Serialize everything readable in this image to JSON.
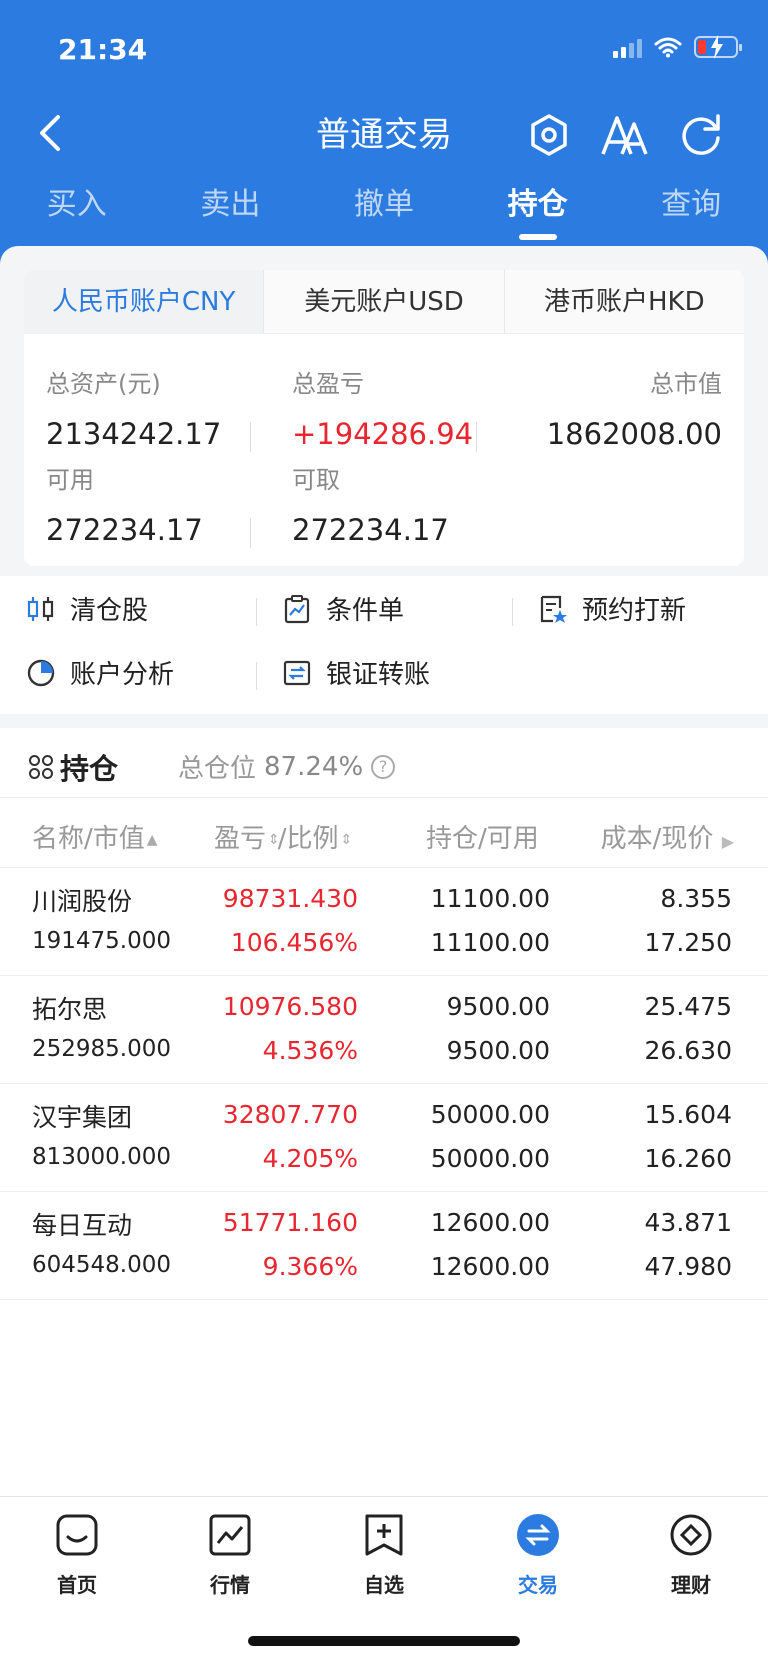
{
  "status_bar": {
    "time": "21:34"
  },
  "nav": {
    "title": "普通交易"
  },
  "tabs": [
    {
      "label": "买入"
    },
    {
      "label": "卖出"
    },
    {
      "label": "撤单"
    },
    {
      "label": "持仓"
    },
    {
      "label": "查询"
    }
  ],
  "account_tabs": [
    {
      "label": "人民币账户CNY"
    },
    {
      "label": "美元账户USD"
    },
    {
      "label": "港币账户HKD"
    }
  ],
  "summary": {
    "total_assets_label": "总资产(元)",
    "total_assets": "2134242.17",
    "total_pl_label": "总盈亏",
    "total_pl": "+194286.94",
    "market_value_label": "总市值",
    "market_value": "1862008.00",
    "available_label": "可用",
    "available": "272234.17",
    "withdrawable_label": "可取",
    "withdrawable": "272234.17"
  },
  "quick_actions": [
    {
      "label": "清仓股"
    },
    {
      "label": "条件单"
    },
    {
      "label": "预约打新"
    },
    {
      "label": "账户分析"
    },
    {
      "label": "银证转账"
    }
  ],
  "holdings": {
    "title": "持仓",
    "position_label": "总仓位",
    "position_value": "87.24%",
    "columns": {
      "name": "名称/市值",
      "pl": "盈亏",
      "ratio": "/比例",
      "qty": "持仓/可用",
      "cost": "成本/现价"
    },
    "rows": [
      {
        "name": "川润股份",
        "market_value": "191475.000",
        "pl": "98731.430",
        "ratio": "106.456%",
        "hold": "11100.00",
        "avail": "11100.00",
        "cost": "8.355",
        "price": "17.250"
      },
      {
        "name": "拓尔思",
        "market_value": "252985.000",
        "pl": "10976.580",
        "ratio": "4.536%",
        "hold": "9500.00",
        "avail": "9500.00",
        "cost": "25.475",
        "price": "26.630"
      },
      {
        "name": "汉宇集团",
        "market_value": "813000.000",
        "pl": "32807.770",
        "ratio": "4.205%",
        "hold": "50000.00",
        "avail": "50000.00",
        "cost": "15.604",
        "price": "16.260"
      },
      {
        "name": "每日互动",
        "market_value": "604548.000",
        "pl": "51771.160",
        "ratio": "9.366%",
        "hold": "12600.00",
        "avail": "12600.00",
        "cost": "43.871",
        "price": "47.980"
      }
    ]
  },
  "bottom_nav": [
    {
      "label": "首页"
    },
    {
      "label": "行情"
    },
    {
      "label": "自选"
    },
    {
      "label": "交易"
    },
    {
      "label": "理财"
    }
  ],
  "colors": {
    "brand": "#2b7be0",
    "gain": "#e8262f"
  }
}
